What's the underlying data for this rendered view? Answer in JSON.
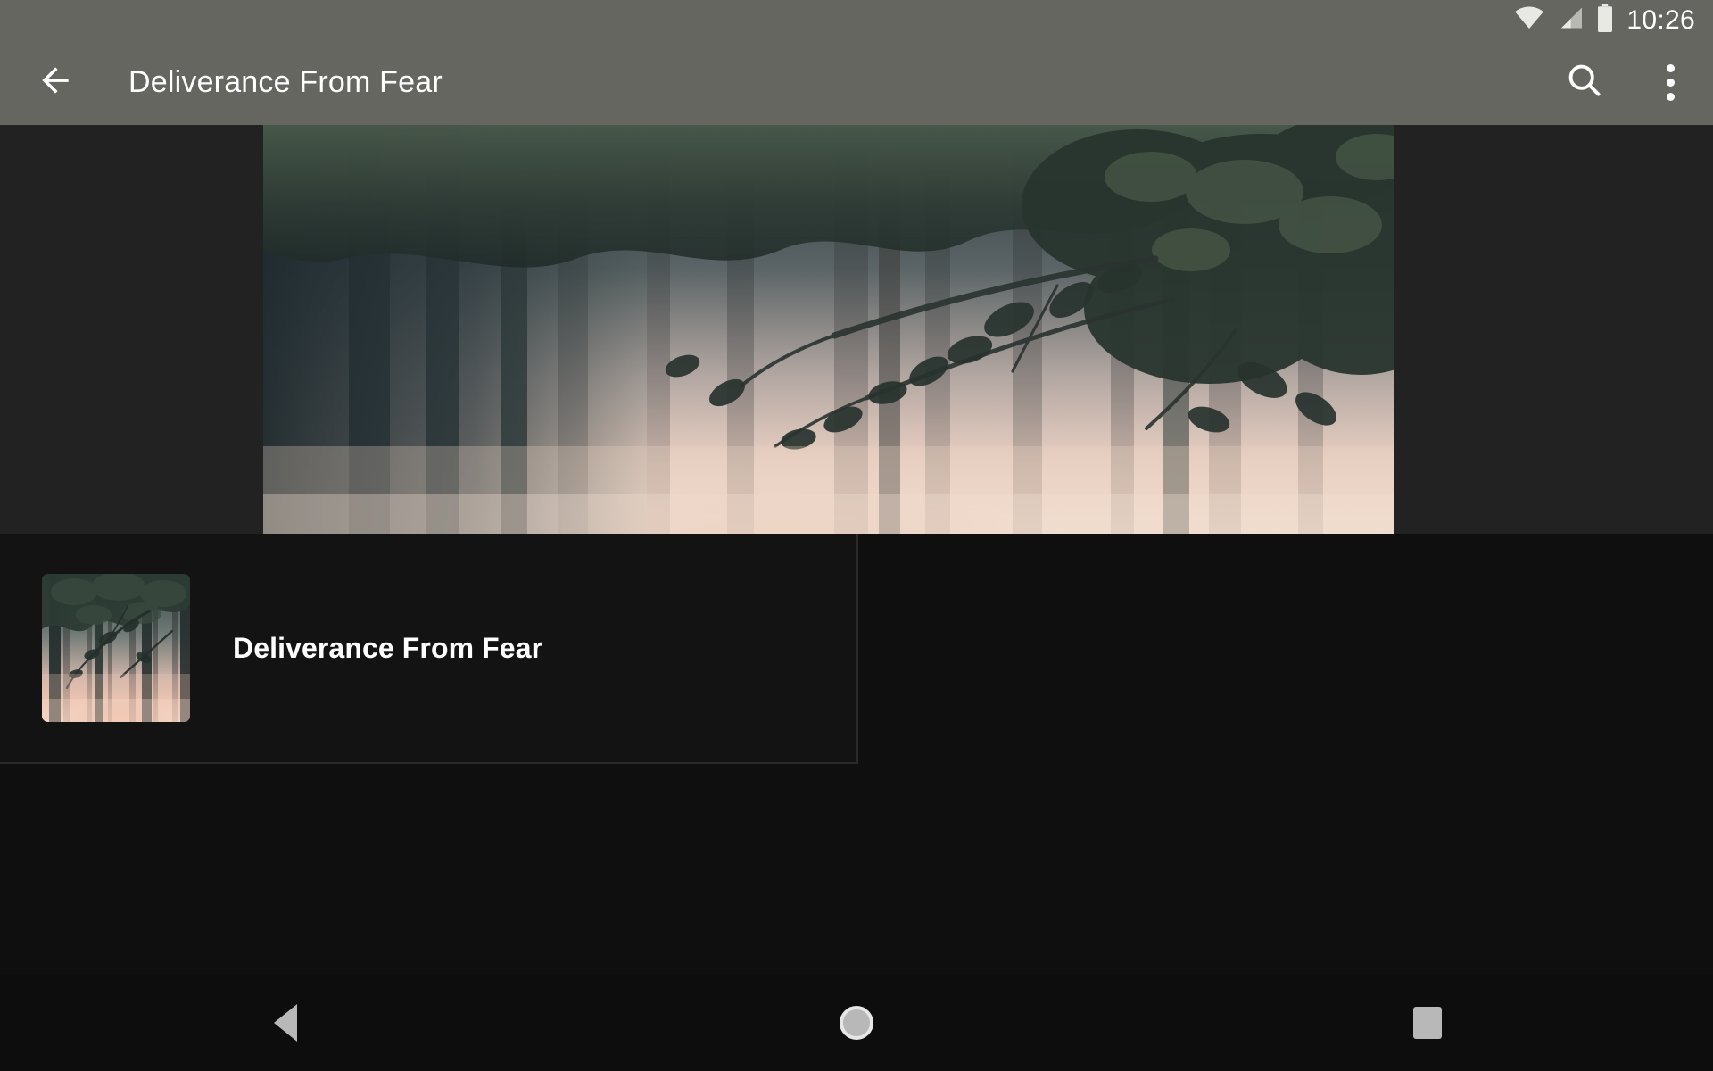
{
  "status_bar": {
    "clock": "10:26",
    "icons": [
      "wifi-icon",
      "cellular-signal-icon",
      "battery-icon"
    ]
  },
  "toolbar": {
    "back_icon": "arrow-back-icon",
    "title": "Deliverance From Fear",
    "search_icon": "search-icon",
    "overflow_icon": "overflow-menu-icon",
    "background_color": "#666660"
  },
  "hero": {
    "image_alt": "misty-forest-sunrise-banner",
    "background_color": "#222222"
  },
  "content": {
    "background_color": "#0f0f0f",
    "items": [
      {
        "title": "Deliverance From Fear",
        "thumbnail_alt": "misty-forest-sunrise-thumbnail"
      }
    ]
  },
  "navigation_bar": {
    "back_label": "back-navigation",
    "home_label": "home-navigation",
    "recents_label": "recent-apps-navigation"
  }
}
